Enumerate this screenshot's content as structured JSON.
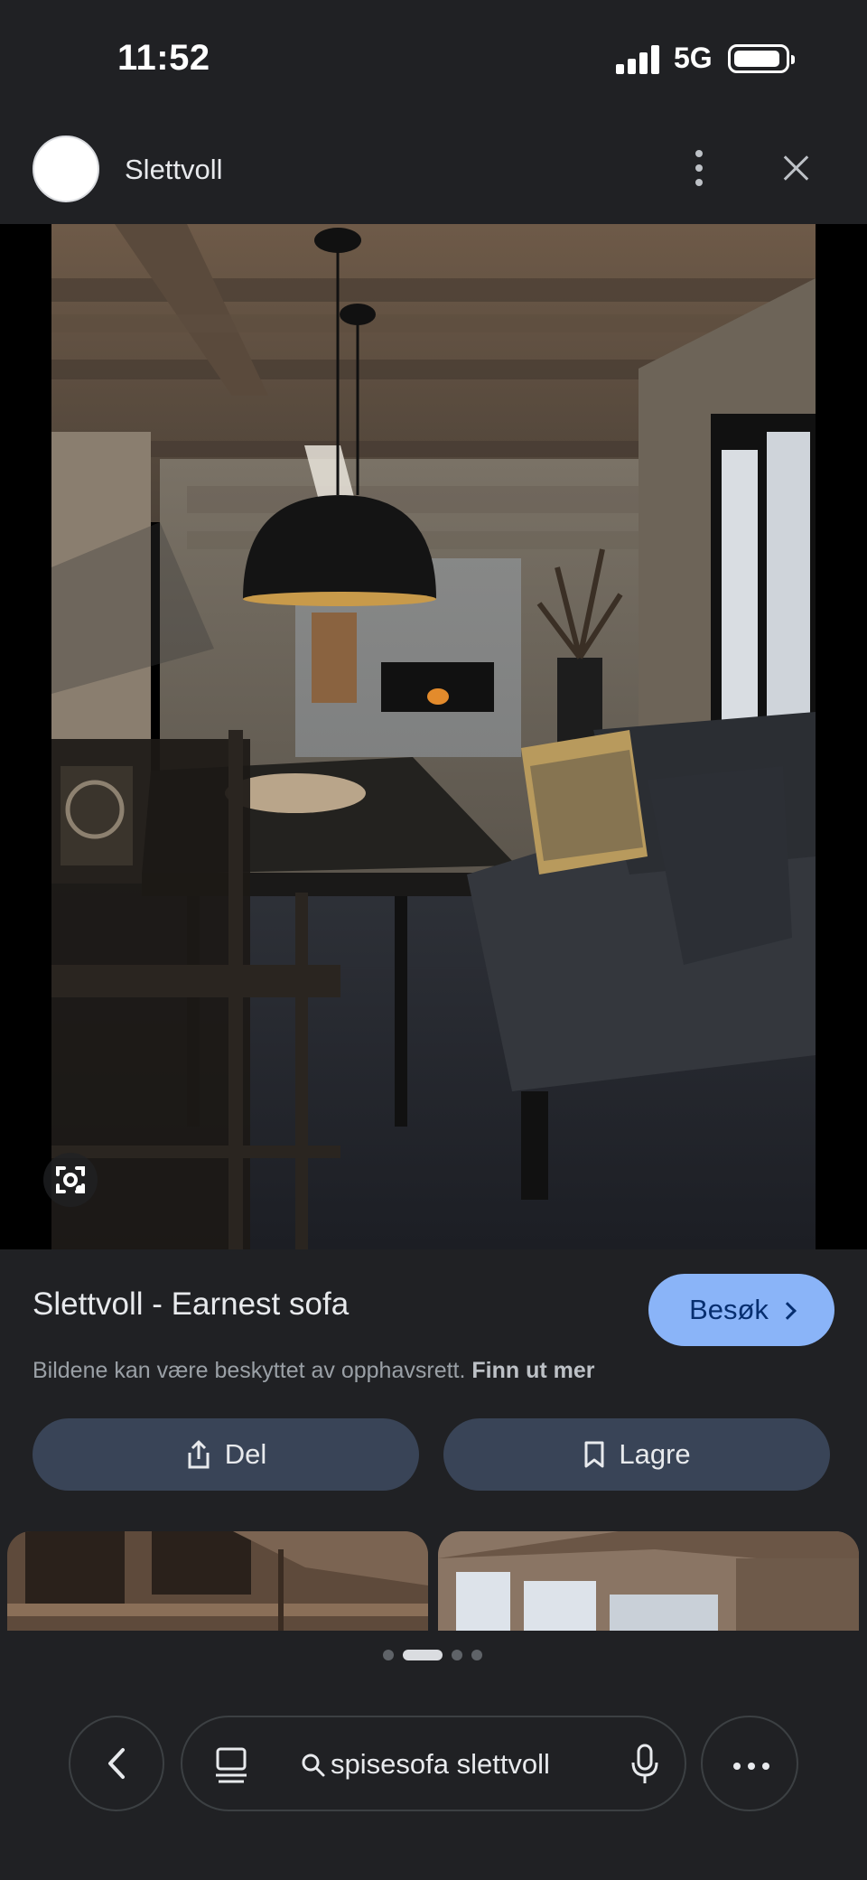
{
  "status_bar": {
    "time": "11:52",
    "network": "5G",
    "battery_level": 0.9
  },
  "source": {
    "name": "Slettvoll"
  },
  "image": {
    "description_icon": "lens-icon"
  },
  "result": {
    "title": "Slettvoll - Earnest sofa",
    "visit_label": "Besøk",
    "copyright_text": "Bildene kan være beskyttet av opphavsrett.",
    "copyright_link": "Finn ut mer"
  },
  "actions": {
    "share_label": "Del",
    "save_label": "Lagre"
  },
  "carousel": {
    "page_count": 4,
    "active_page": 2
  },
  "search": {
    "query": "spisesofa slettvoll"
  },
  "colors": {
    "background": "#202124",
    "accent": "#8ab4f8",
    "action_button": "#394457"
  }
}
